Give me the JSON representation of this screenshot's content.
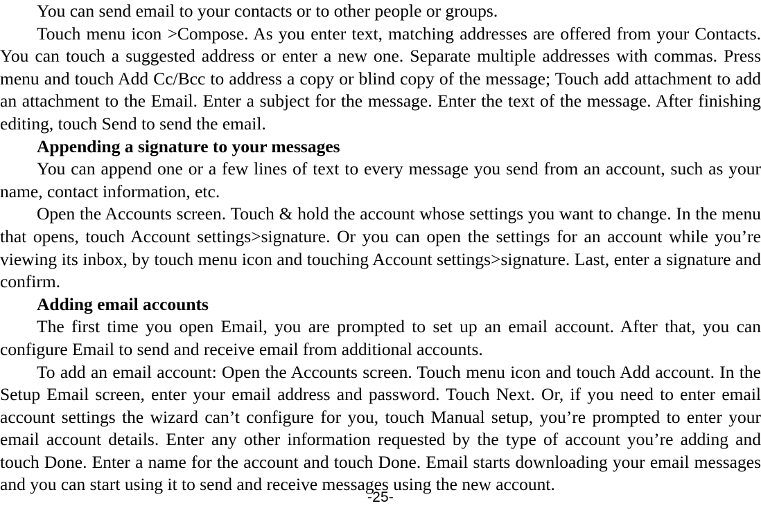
{
  "document": {
    "page_number_label": "-25-",
    "blocks": [
      {
        "kind": "paragraph-tail",
        "text": "You can send email to your contacts or to other people or groups."
      },
      {
        "kind": "paragraph",
        "text": "Touch menu icon >Compose. As you enter text, matching addresses are offered from your Contacts. You can touch a suggested address or enter a new one. Separate multiple addresses with commas. Press menu and touch Add Cc/Bcc to address a copy or blind copy of the message; Touch add attachment to add an attachment to the Email. Enter a subject for the message. Enter the text of the message. After finishing editing, touch Send to send the email."
      },
      {
        "kind": "heading",
        "text": "Appending a signature to your messages"
      },
      {
        "kind": "paragraph",
        "text": "You can append one or a few lines of text to every message you send from an account, such as your name, contact information, etc."
      },
      {
        "kind": "paragraph",
        "text": "Open the Accounts screen. Touch & hold the account whose settings you want to change. In the menu that opens, touch Account settings>signature. Or you can open the settings for an account while you’re viewing its inbox, by touch menu icon and touching Account settings>signature. Last, enter a signature and confirm."
      },
      {
        "kind": "heading",
        "text": "Adding email accounts"
      },
      {
        "kind": "paragraph",
        "text": "The first time you open Email, you are prompted to set up an email account. After that, you can configure Email to send and receive email from additional accounts."
      },
      {
        "kind": "paragraph",
        "text": "To add an email account: Open the Accounts screen. Touch menu icon and touch Add account. In the Setup Email screen, enter your email address and password. Touch Next. Or, if you need to enter email account settings the wizard can’t configure for you, touch Manual setup, you’re prompted to enter your email account details. Enter any other information requested by the type of account you’re adding and touch Done. Enter a name for the account and touch Done. Email starts downloading your email messages and you can start using it to send and receive messages using the new account."
      }
    ]
  }
}
